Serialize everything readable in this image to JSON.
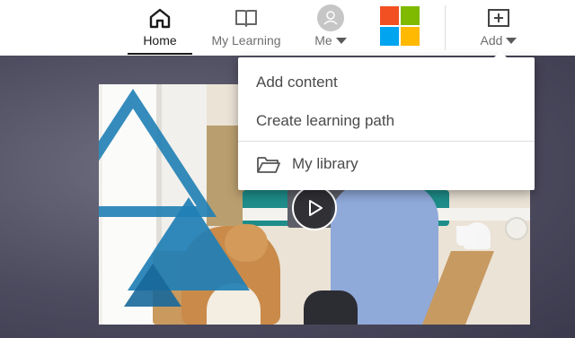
{
  "nav": {
    "home_label": "Home",
    "learning_label": "My Learning",
    "me_label": "Me",
    "add_label": "Add"
  },
  "brand": {
    "logo": "microsoft-logo",
    "colors": [
      "#f25022",
      "#7fba00",
      "#00a4ef",
      "#ffb900"
    ]
  },
  "menu": {
    "items": [
      {
        "label": "Add content"
      },
      {
        "label": "Create learning path"
      },
      {
        "label": "My library",
        "icon": "folder-icon"
      }
    ]
  },
  "video": {
    "play_icon": "play-icon"
  },
  "colors": {
    "accent_triangle": "#1f7fb5",
    "active_nav": "#1a1a1a"
  }
}
